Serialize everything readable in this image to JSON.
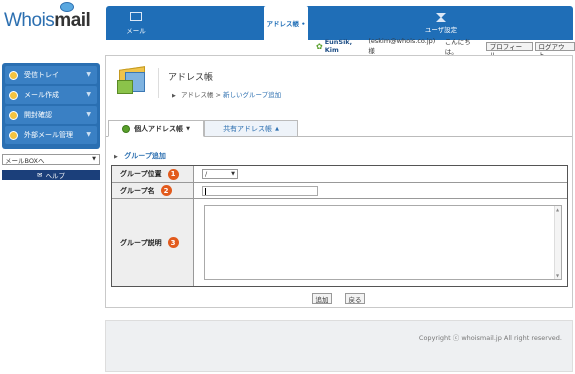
{
  "logo": {
    "whois": "Whois",
    "mail": "mail"
  },
  "nav": {
    "mail": "メール",
    "address": "アドレス帳",
    "address_dot": "•",
    "user_settings": "ユーザ設定"
  },
  "user": {
    "name": "EunSik, Kim",
    "email": "(eskim@whois.co.jp)様",
    "greeting": "こんにちは。",
    "profile_button": "プロフィール",
    "logout_button": "ログアウト"
  },
  "sidebar": {
    "items": [
      {
        "label": "受信トレイ"
      },
      {
        "label": "メール作成"
      },
      {
        "label": "開封確認"
      },
      {
        "label": "外部メール管理"
      }
    ],
    "mailbox_select": "メールBOXへ",
    "help": "ヘルプ"
  },
  "page": {
    "title": "アドレス帳",
    "breadcrumb_root": "アドレス帳",
    "breadcrumb_sep": ">",
    "breadcrumb_current": "新しいグループ追加"
  },
  "tabs": {
    "personal": "個人アドレス帳",
    "shared": "共有アドレス帳"
  },
  "section": {
    "title": "グループ追加"
  },
  "form": {
    "rows": [
      {
        "label": "グループ位置",
        "badge": "1",
        "select_value": "/"
      },
      {
        "label": "グループ名",
        "badge": "2",
        "input_value": ""
      },
      {
        "label": "グループ説明",
        "badge": "3",
        "textarea_value": ""
      }
    ],
    "add_button": "追加",
    "back_button": "戻る"
  },
  "footer": {
    "copyright": "Copyright ⓒ whoismail.jp All right reserved."
  },
  "colors": {
    "primary": "#1f6eb7",
    "badge": "#e25a1c",
    "help_bg": "#1b3f7a"
  }
}
